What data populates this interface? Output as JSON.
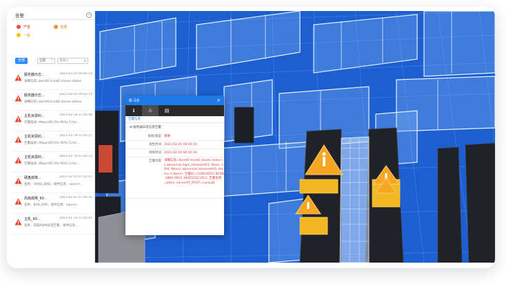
{
  "panel": {
    "title": "告警",
    "collapse_label": "—",
    "legend": [
      {
        "label": "严重",
        "color": "#e8432e",
        "icon": "!"
      },
      {
        "label": "重要",
        "color": "#f08a1c",
        "icon": "!"
      },
      {
        "label": "一般",
        "color": "#f1c40f",
        "icon": ""
      }
    ],
    "filter": {
      "all_label": "全部",
      "select_value": "全部",
      "search_placeholder": "请输入"
    },
    "alarms": [
      {
        "name": "服务器日志…",
        "time": "2021-02-20 06:02:14",
        "desc": "详细信息=bond0 trunk0 slaves status"
      },
      {
        "name": "服务器日志…",
        "time": "2021-02-20 06:02:14",
        "desc": "详细信息=bond0 trunk0 slaves status"
      },
      {
        "name": "主机资源利…",
        "time": "2021-02-19 11:02:48",
        "desc": "告警描述=Major(85.0%-95%) Critic…"
      },
      {
        "name": "主机资源利…",
        "time": "2021-02-19 11:02:27",
        "desc": "告警描述=Major(85.0%-95%) Critic…"
      },
      {
        "name": "主机资源利…",
        "time": "2021-02-19 11:02:14",
        "desc": "告警描述=Major(85.0%-95%) Critic…"
      },
      {
        "name": "硬盘故障…",
        "time": "2021-02-01 07:02:47",
        "desc": "名称：HARD_BAD，组件信息：source…"
      },
      {
        "name": "风扇故障_60…",
        "time": "2021-02-01 07:02:42",
        "desc": "名称：BUS_ERR，组件信息：source…"
      },
      {
        "name": "主机_60…",
        "time": "2021-01-24 11:01:41",
        "desc": "名称：风扇PWM异常告警，组件信息…"
      }
    ]
  },
  "popup": {
    "title": "B-16",
    "close": "×",
    "subtitle": "告警信息",
    "group": "服务器日志信息告警",
    "rows": [
      {
        "label": "级别/类型",
        "value": "重要"
      },
      {
        "label": "发生时间",
        "value": "2021-02-20 06:02:14"
      },
      {
        "label": "持续时间",
        "value": "2021-02-20 06:02:14"
      },
      {
        "label": "告警内容",
        "value": "详细信息=bond0 trunk0 slaves status is abnormal,logic_slaves(eth1: None, eth0: None), abnormal slaves(eth0: status is None), 告警ID=CADG4D5C-8D1B-188A-0911-184E1E1E14C2, 告警名称=other_server07_POST=cuclusB"
      }
    ]
  }
}
